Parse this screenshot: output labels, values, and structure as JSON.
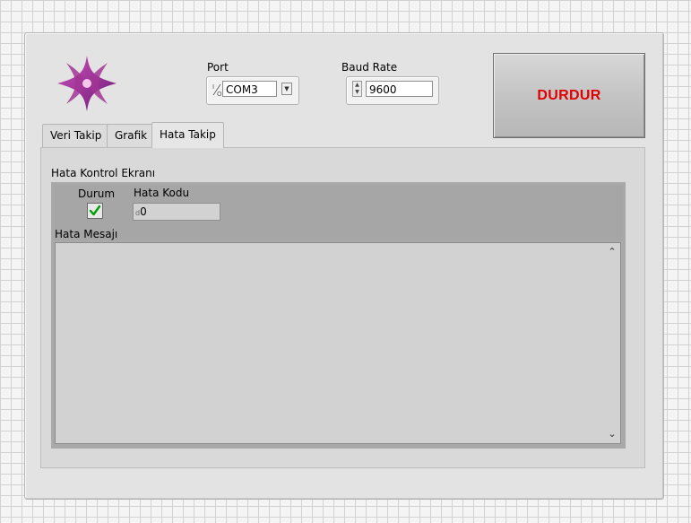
{
  "controls": {
    "port": {
      "label": "Port",
      "value": "COM3",
      "io_glyph": "I/O",
      "dropdown_icon": "dropdown-arrow"
    },
    "baud_rate": {
      "label": "Baud Rate",
      "value": "9600"
    },
    "stop_button": {
      "label": "DURDUR",
      "color": "#e00000"
    }
  },
  "tabs": [
    {
      "label": "Veri Takip",
      "active": false
    },
    {
      "label": "Grafik",
      "active": false
    },
    {
      "label": "Hata Takip",
      "active": true
    }
  ],
  "error_panel": {
    "title": "Hata Kontrol Ekranı",
    "status": {
      "label": "Durum",
      "checked": true
    },
    "code": {
      "label": "Hata Kodu",
      "value": "0",
      "prefix": "d"
    },
    "message": {
      "label": "Hata Mesajı",
      "value": ""
    }
  },
  "colors": {
    "panel": "#e3e3e3",
    "cluster": "#a9a9a9",
    "stop_text": "#e00000",
    "check": "#00a000"
  }
}
